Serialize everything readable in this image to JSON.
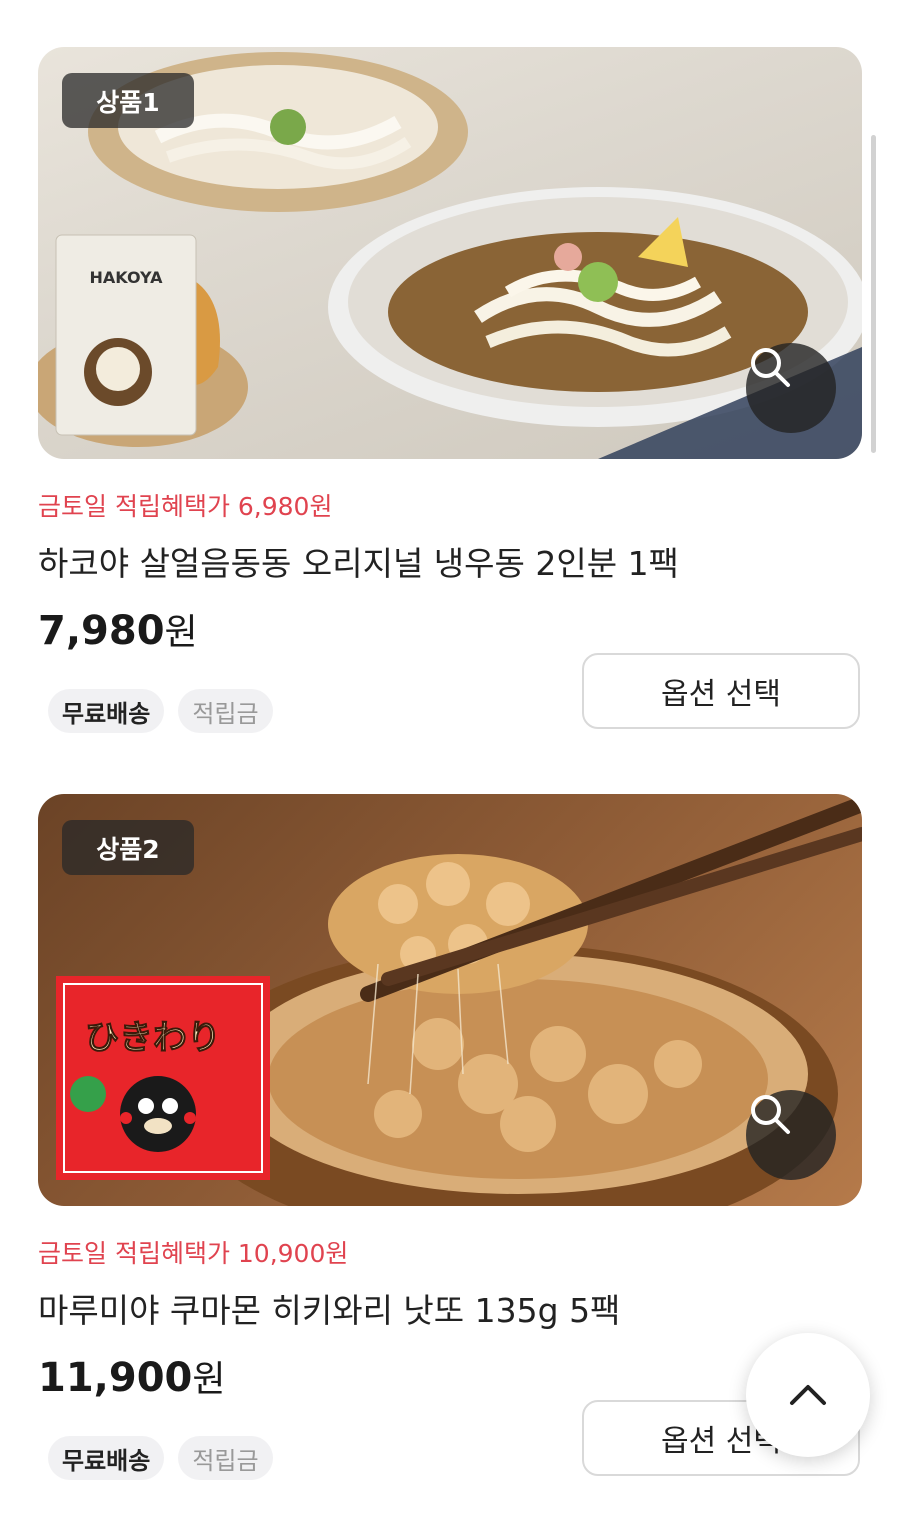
{
  "products": [
    {
      "badge": "상품1",
      "benefit": "금토일 적립혜택가 6,980원",
      "name": "하코야 살얼음동동 오리지널 냉우동 2인분 1팩",
      "price": "7,980",
      "currency": "원",
      "tags": [
        "무료배송",
        "적립금"
      ],
      "option_label": "옵션 선택",
      "package_brand": "HAKOYA"
    },
    {
      "badge": "상품2",
      "benefit": "금토일 적립혜택가 10,900원",
      "name": "마루미야 쿠마몬 히키와리 낫또 135g 5팩",
      "price": "11,900",
      "currency": "원",
      "tags": [
        "무료배송",
        "적립금"
      ],
      "option_label": "옵션 선택",
      "package_brand": "ひきわり"
    }
  ],
  "icons": {
    "zoom": "magnifier-icon",
    "scroll_top": "chevron-up-icon"
  },
  "colors": {
    "benefit": "#e0434f",
    "badge_bg": "#2b2b2b",
    "tag_bg": "#f1f1f3"
  }
}
